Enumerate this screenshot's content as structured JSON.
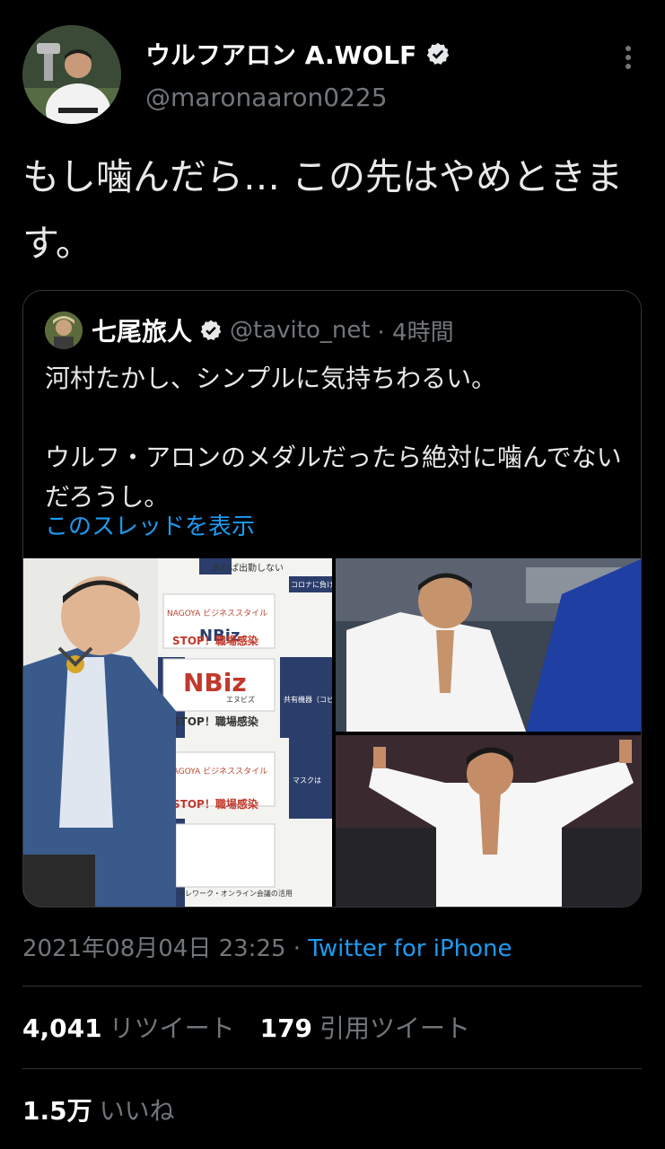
{
  "tweet": {
    "display_name": "ウルフアロン A.WOLF",
    "handle": "@maronaaron0225",
    "text": "もし噛んだら… この先はやめときます。",
    "timestamp": "2021年08月04日 23:25",
    "separator": " · ",
    "source": "Twitter for iPhone"
  },
  "quote": {
    "display_name": "七尾旅人",
    "handle": "@tavito_net",
    "time": "· 4時間",
    "line1": "河村たかし、シンプルに気持ちわるい。",
    "line2": "ウルフ・アロンのメダルだったら絶対に噛んでないだろうし。",
    "show_thread": "このスレッドを表示",
    "poster_texts": {
      "banner1": "コロナに負けるな！",
      "brand": "NBiz",
      "brand_sub": "エヌビズ",
      "stop1": "STOP！職場感染",
      "stop2": "STOP！職場感染",
      "stop3": "STOP！職場感染",
      "nagoya": "NAGOYA ビジネススタイル",
      "nagoya2": "NAGOYA ビジネススタイル",
      "top": "あれば出勤しない",
      "telework": "テレワーク・オンライン会議の活用",
      "mask": "マスクは",
      "copy": "共有機器（コピー機）"
    }
  },
  "stats": {
    "retweets": "4,041",
    "retweets_label": "リツイート",
    "quotes": "179",
    "quotes_label": "引用ツイート",
    "likes": "1.5万",
    "likes_label": "いいね"
  },
  "colors": {
    "background": "#000000",
    "text": "#e7e9ea",
    "muted": "#71767b",
    "link": "#1d9bf0",
    "border": "#2f3336"
  }
}
